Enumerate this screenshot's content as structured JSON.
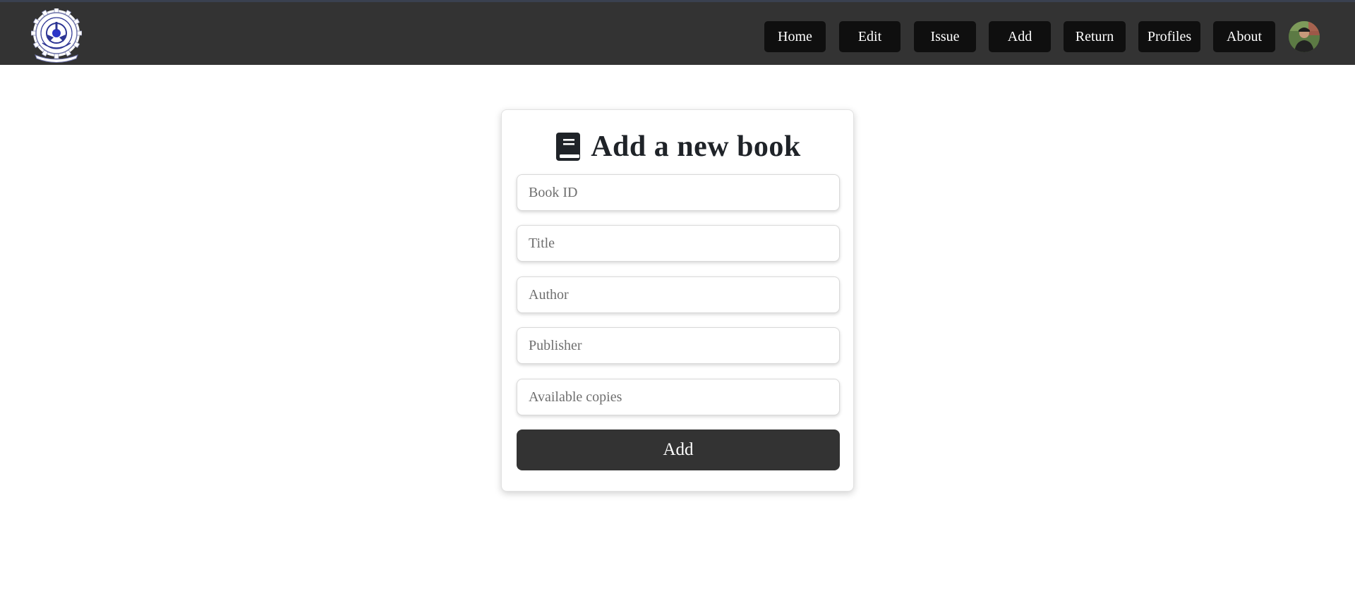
{
  "navbar": {
    "logo_icon": "institute-emblem-icon",
    "items": [
      {
        "label": "Home"
      },
      {
        "label": "Edit"
      },
      {
        "label": "Issue"
      },
      {
        "label": "Add"
      },
      {
        "label": "Return"
      },
      {
        "label": "Profiles"
      },
      {
        "label": "About"
      }
    ],
    "avatar_icon": "user-avatar-icon",
    "background_color": "#333333",
    "button_color": "#0f0f0f"
  },
  "form": {
    "icon": "book-icon",
    "title": "Add a new book",
    "fields": [
      {
        "placeholder": "Book ID",
        "value": ""
      },
      {
        "placeholder": "Title",
        "value": ""
      },
      {
        "placeholder": "Author",
        "value": ""
      },
      {
        "placeholder": "Publisher",
        "value": ""
      },
      {
        "placeholder": "Available copies",
        "value": ""
      }
    ],
    "submit_label": "Add",
    "submit_color": "#333333"
  }
}
